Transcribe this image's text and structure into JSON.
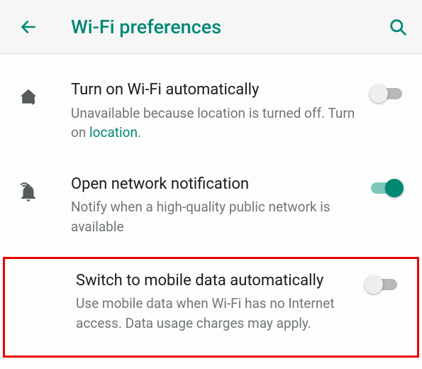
{
  "header": {
    "title": "Wi-Fi preferences"
  },
  "items": {
    "autoWifi": {
      "title": "Turn on Wi-Fi automatically",
      "sub_pre": "Unavailable because location is turned off. Turn on ",
      "sub_link": "location",
      "sub_post": ".",
      "on": false
    },
    "openNet": {
      "title": "Open network notification",
      "sub": "Notify when a high-quality public network is available",
      "on": true
    },
    "switchMobile": {
      "title": "Switch to mobile data automatically",
      "sub": "Use mobile data when Wi-Fi has no Internet access. Data usage charges may apply.",
      "on": false
    }
  }
}
